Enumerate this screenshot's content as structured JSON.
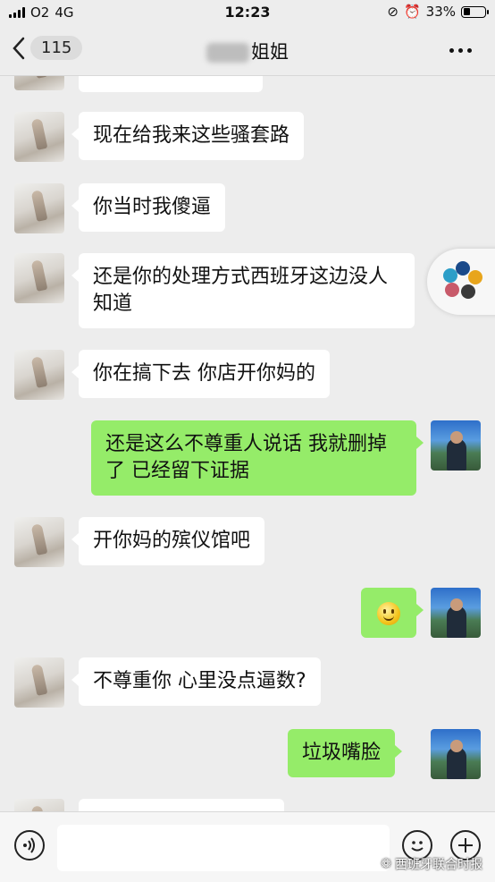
{
  "status_bar": {
    "carrier": "O2",
    "network": "4G",
    "time": "12:23",
    "battery": "33%",
    "battery_level": 0.33
  },
  "nav": {
    "back_count": "115",
    "title": "姐姐"
  },
  "messages": [
    {
      "side": "in",
      "text": ""
    },
    {
      "side": "in",
      "text": "现在给我来这些骚套路"
    },
    {
      "side": "in",
      "text": "你当时我傻逼"
    },
    {
      "side": "in",
      "text": "还是你的处理方式西班牙这边没人知道"
    },
    {
      "side": "in",
      "text": "你在搞下去 你店开你妈的"
    },
    {
      "side": "out",
      "text": "还是这么不尊重人说话  我就删掉了  已经留下证据"
    },
    {
      "side": "in",
      "text": "开你妈的殡仪馆吧"
    },
    {
      "side": "out",
      "text": "",
      "emoji": "smiley-emoji"
    },
    {
      "side": "in",
      "text": "不尊重你 心里没点逼数?"
    },
    {
      "side": "out",
      "text": "垃圾嘴脸"
    },
    {
      "side": "in",
      "text": ""
    }
  ],
  "input": {
    "value": "",
    "placeholder": ""
  },
  "watermark": "西班牙联合时报",
  "colors": {
    "background": "#ededed",
    "incoming_bubble": "#ffffff",
    "outgoing_bubble": "#95ec69"
  }
}
